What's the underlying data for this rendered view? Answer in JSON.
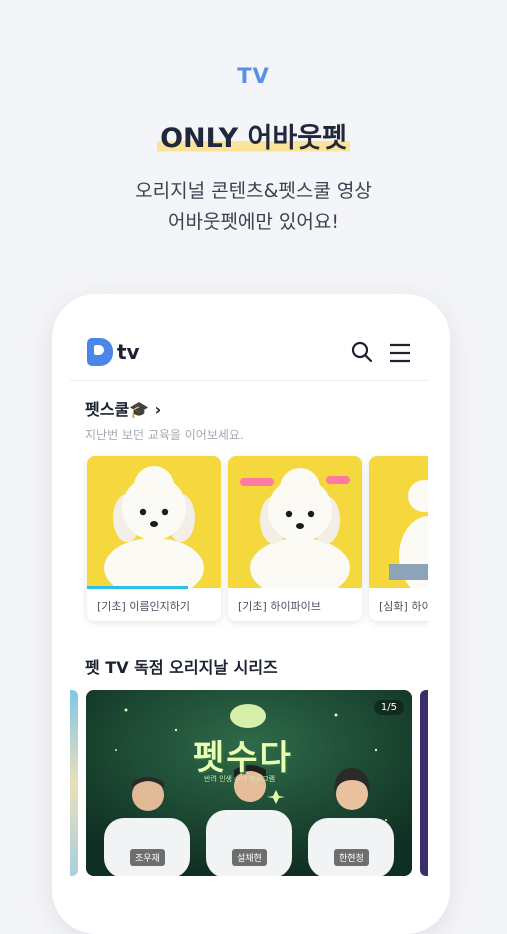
{
  "promo": {
    "label": "TV",
    "title": "ONLY 어바웃펫",
    "subtitle_line1": "오리지널 콘텐츠&펫스쿨 영상",
    "subtitle_line2": "어바웃펫에만 있어요!"
  },
  "app": {
    "logo_text": "tv",
    "icons": {
      "search": "search-icon",
      "menu": "menu-icon"
    }
  },
  "petschool": {
    "title": "펫스쿨🎓 ›",
    "subtitle": "지난번 보던 교육을 이어보세요.",
    "cards": [
      {
        "caption": "[기초] 이름인지하기",
        "progress": 0.75,
        "badge": ""
      },
      {
        "caption": "[기초] 하이파이브",
        "progress": 0,
        "badge": ""
      },
      {
        "caption": "[심화] 하이",
        "progress": 0,
        "badge": ""
      }
    ]
  },
  "series": {
    "title": "펫 TV 독점 오리지날 시리즈",
    "banner": {
      "pager": "1/5",
      "show_title": "펫수다",
      "show_sub": "반려 인생 수다 프로그램",
      "hosts": [
        "조우재",
        "설채현",
        "한현정"
      ]
    }
  },
  "colors": {
    "accent": "#5b8fe6",
    "highlight": "#fbe49a",
    "card_bg": "#f5d83d",
    "progress": "#2ec1e6",
    "banner_bg": "#123a2a"
  }
}
